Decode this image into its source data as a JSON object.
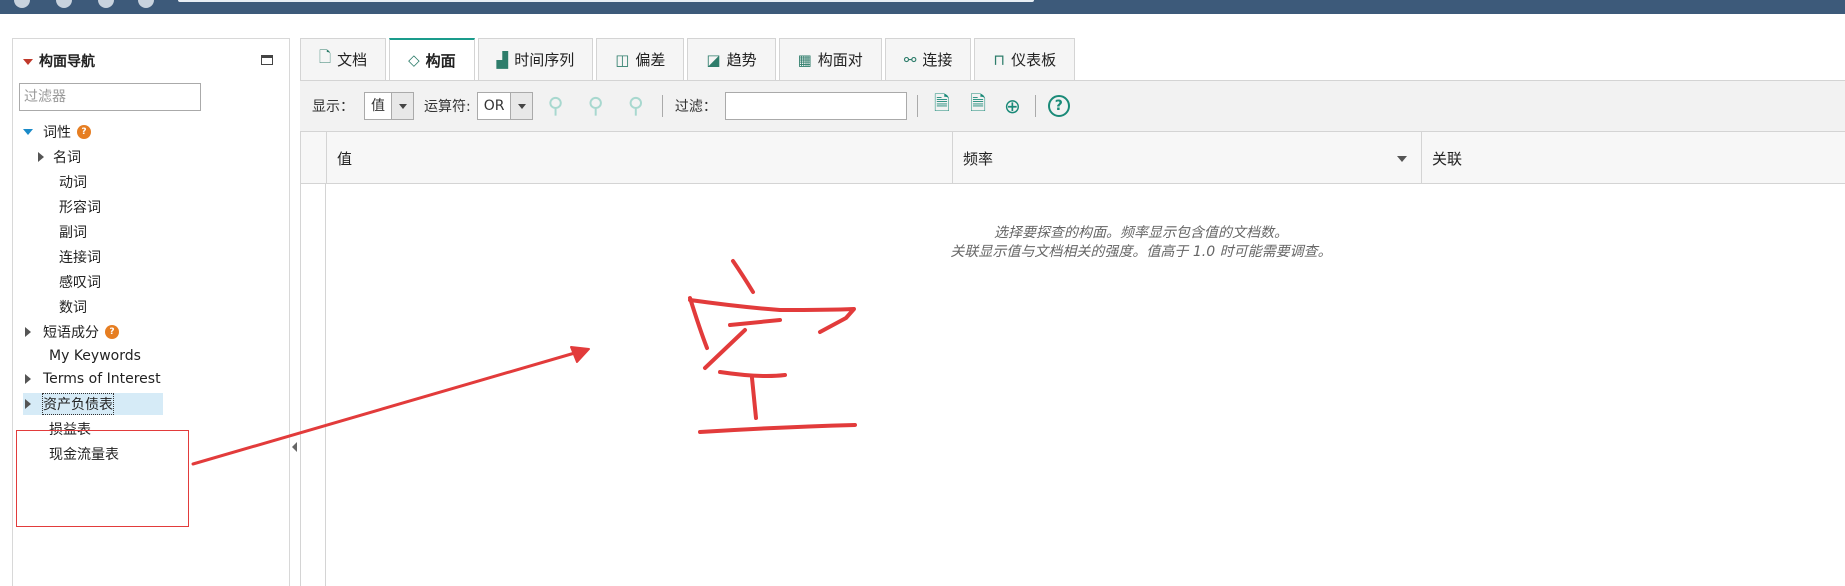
{
  "nav": {
    "title": "构面导航",
    "filter_placeholder": "过滤器",
    "tree": [
      {
        "label": "词性",
        "expanded": true,
        "badge": true
      },
      {
        "label": "名词",
        "child": true,
        "has_children": true
      },
      {
        "label": "动词",
        "child": true
      },
      {
        "label": "形容词",
        "child": true
      },
      {
        "label": "副词",
        "child": true
      },
      {
        "label": "连接词",
        "child": true
      },
      {
        "label": "感叹词",
        "child": true
      },
      {
        "label": "数词",
        "child": true
      },
      {
        "label": "短语成分",
        "has_children": true,
        "badge": true
      },
      {
        "label": "My Keywords"
      },
      {
        "label": "Terms of Interest",
        "has_children": true
      },
      {
        "label": "资产负债表",
        "has_children": true,
        "selected": true
      },
      {
        "label": "损益表"
      },
      {
        "label": "现金流量表"
      }
    ]
  },
  "tabs": [
    {
      "label": "文档",
      "icon": "document-icon"
    },
    {
      "label": "构面",
      "icon": "diamond-icon",
      "active": true
    },
    {
      "label": "时间序列",
      "icon": "area-chart-icon"
    },
    {
      "label": "偏差",
      "icon": "line-chart-icon"
    },
    {
      "label": "趋势",
      "icon": "trend-chart-icon"
    },
    {
      "label": "构面对",
      "icon": "table-icon"
    },
    {
      "label": "连接",
      "icon": "connection-icon"
    },
    {
      "label": "仪表板",
      "icon": "dashboard-icon"
    }
  ],
  "toolbar": {
    "display_label": "显示：",
    "display_value": "值",
    "operator_label": "运算符:",
    "operator_value": "OR",
    "filter_label": "过滤：",
    "filter_value": ""
  },
  "grid": {
    "columns": [
      "值",
      "频率",
      "关联"
    ],
    "empty_line1": "选择要探查的构面。频率显示包含值的文档数。",
    "empty_line2": "关联显示值与文档相关的强度。值高于 1.0 时可能需要调查。"
  },
  "annotation": {
    "handwritten_text": "空",
    "color": "#e23b3b"
  }
}
